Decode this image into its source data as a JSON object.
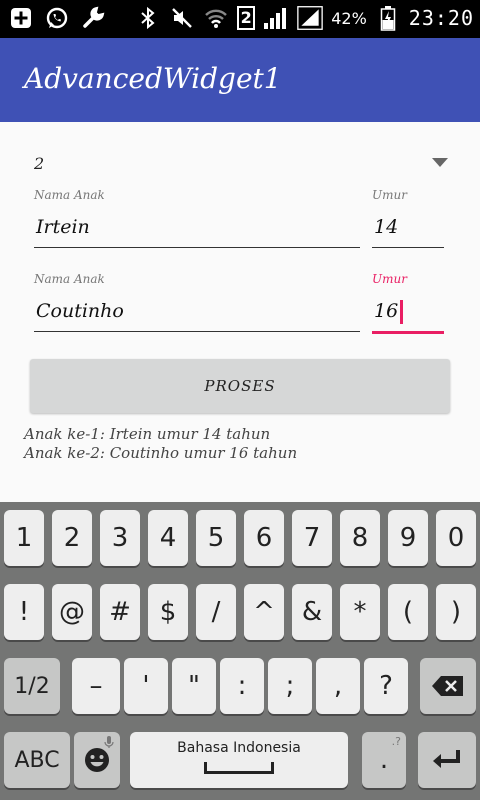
{
  "status_bar": {
    "sim_label": "2",
    "battery_percent": "42%",
    "time": "23:20",
    "icons": [
      "plus-box-icon",
      "whatsapp-icon",
      "wrench-icon",
      "bluetooth-icon",
      "mute-icon",
      "wifi-icon",
      "signal-icon",
      "battery-charging-icon"
    ]
  },
  "app_bar": {
    "title": "AdvancedWidget1"
  },
  "spinner": {
    "value": "2"
  },
  "children": [
    {
      "name_label": "Nama Anak",
      "name_value": "Irtein",
      "age_label": "Umur",
      "age_value": "14"
    },
    {
      "name_label": "Nama Anak",
      "name_value": "Coutinho",
      "age_label": "Umur",
      "age_value": "16"
    }
  ],
  "button": {
    "label": "PROSES"
  },
  "results": [
    "Anak ke-1: Irtein umur 14 tahun",
    "Anak ke-2: Coutinho umur 16 tahun"
  ],
  "keyboard": {
    "row1": [
      "1",
      "2",
      "3",
      "4",
      "5",
      "6",
      "7",
      "8",
      "9",
      "0"
    ],
    "row2": [
      "!",
      "@",
      "#",
      "$",
      "/",
      "^",
      "&",
      "*",
      "(",
      ")"
    ],
    "row3": [
      "1/2",
      "–",
      "'",
      "\"",
      ":",
      ";",
      ",",
      "?"
    ],
    "row4": {
      "abc": "ABC",
      "space": "Bahasa Indonesia",
      "period": "."
    },
    "colors": {
      "key": "#eeeeee",
      "function_key": "#c6c7c6",
      "background": "#747574"
    }
  },
  "colors": {
    "app_bar": "#3f51b5",
    "accent": "#e91e63"
  }
}
